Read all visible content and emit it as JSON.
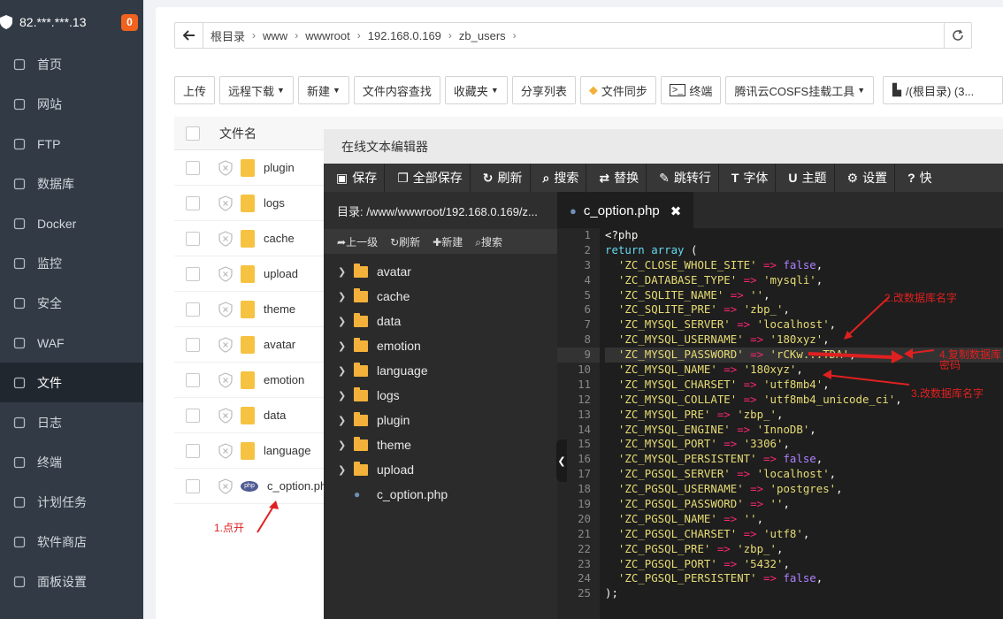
{
  "sidebar": {
    "server_ip": "82.***.***.13",
    "badge": "0",
    "items": [
      {
        "label": "首页",
        "icon": "home-icon"
      },
      {
        "label": "网站",
        "icon": "globe-icon"
      },
      {
        "label": "FTP",
        "icon": "ftp-icon"
      },
      {
        "label": "数据库",
        "icon": "database-icon"
      },
      {
        "label": "Docker",
        "icon": "docker-icon"
      },
      {
        "label": "监控",
        "icon": "monitor-icon"
      },
      {
        "label": "安全",
        "icon": "shield-check-icon"
      },
      {
        "label": "WAF",
        "icon": "waf-icon"
      },
      {
        "label": "文件",
        "icon": "folder-icon"
      },
      {
        "label": "日志",
        "icon": "log-icon"
      },
      {
        "label": "终端",
        "icon": "terminal-icon"
      },
      {
        "label": "计划任务",
        "icon": "calendar-icon"
      },
      {
        "label": "软件商店",
        "icon": "grid-icon"
      },
      {
        "label": "面板设置",
        "icon": "settings-icon"
      }
    ]
  },
  "breadcrumb": [
    "根目录",
    "www",
    "wwwroot",
    "192.168.0.169",
    "zb_users"
  ],
  "toolbar": [
    "上传",
    "远程下载",
    "新建",
    "文件内容查找",
    "收藏夹",
    "分享列表",
    "文件同步",
    "终端",
    "腾讯云COSFS挂载工具",
    "/(根目录) (3..."
  ],
  "file_table": {
    "header": "文件名",
    "files": [
      "plugin",
      "logs",
      "cache",
      "upload",
      "theme",
      "avatar",
      "emotion",
      "data",
      "language",
      "c_option.php"
    ]
  },
  "annotations": {
    "step1": "1.点开",
    "step2": "2.改数据库名字",
    "step3": "3.改数据库名字",
    "step4": "4.复制数据库密码"
  },
  "editor": {
    "title": "在线文本编辑器",
    "buttons": [
      "保存",
      "全部保存",
      "刷新",
      "搜索",
      "替换",
      "跳转行",
      "字体",
      "主题",
      "设置",
      "快"
    ],
    "dir_label": "目录: /www/wwwroot/192.168.0.169/z...",
    "dir_tools": [
      "上一级",
      "刷新",
      "新建",
      "搜索"
    ],
    "tree_folders": [
      "avatar",
      "cache",
      "data",
      "emotion",
      "language",
      "logs",
      "plugin",
      "theme",
      "upload"
    ],
    "tree_file": "c_option.php",
    "tab": "c_option.php",
    "code_lines": [
      "<?php",
      "return array (",
      "  'ZC_CLOSE_WHOLE_SITE' => false,",
      "  'ZC_DATABASE_TYPE' => 'mysqli',",
      "  'ZC_SQLITE_NAME' => '',",
      "  'ZC_SQLITE_PRE' => 'zbp_',",
      "  'ZC_MYSQL_SERVER' => 'localhost',",
      "  'ZC_MYSQL_USERNAME' => '180xyz',",
      "  'ZC_MYSQL_PASSWORD' => 'rCKw...TDA',",
      "  'ZC_MYSQL_NAME' => '180xyz',",
      "  'ZC_MYSQL_CHARSET' => 'utf8mb4',",
      "  'ZC_MYSQL_COLLATE' => 'utf8mb4_unicode_ci',",
      "  'ZC_MYSQL_PRE' => 'zbp_',",
      "  'ZC_MYSQL_ENGINE' => 'InnoDB',",
      "  'ZC_MYSQL_PORT' => '3306',",
      "  'ZC_MYSQL_PERSISTENT' => false,",
      "  'ZC_PGSQL_SERVER' => 'localhost',",
      "  'ZC_PGSQL_USERNAME' => 'postgres',",
      "  'ZC_PGSQL_PASSWORD' => '',",
      "  'ZC_PGSQL_NAME' => '',",
      "  'ZC_PGSQL_CHARSET' => 'utf8',",
      "  'ZC_PGSQL_PRE' => 'zbp_',",
      "  'ZC_PGSQL_PORT' => '5432',",
      "  'ZC_PGSQL_PERSISTENT' => false,",
      ");"
    ]
  },
  "colors": {
    "sidebar_bg": "#323b45",
    "badge": "#f0621e",
    "annotation": "#e02020",
    "editor_bg": "#1e1e1e"
  }
}
